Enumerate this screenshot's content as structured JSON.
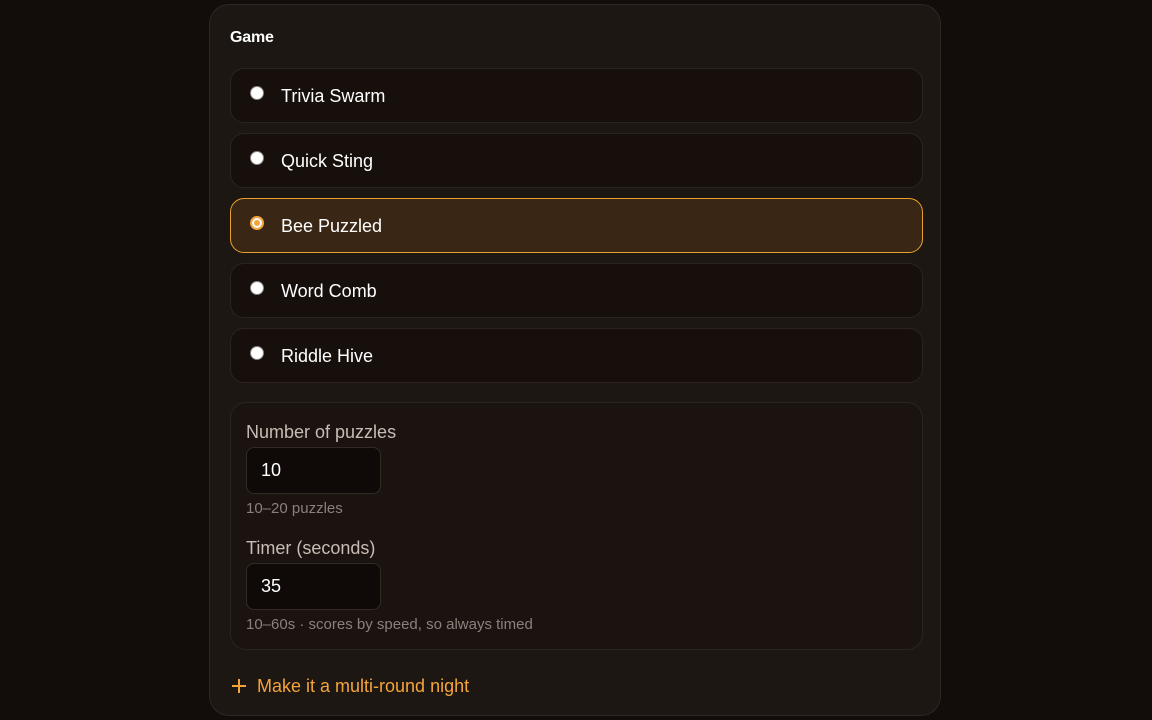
{
  "section": {
    "title": "Game"
  },
  "games": [
    {
      "label": "Trivia Swarm",
      "selected": false
    },
    {
      "label": "Quick Sting",
      "selected": false
    },
    {
      "label": "Bee Puzzled",
      "selected": true
    },
    {
      "label": "Word Comb",
      "selected": false
    },
    {
      "label": "Riddle Hive",
      "selected": false
    }
  ],
  "settings": {
    "puzzles": {
      "label": "Number of puzzles",
      "value": "10",
      "hint": "10–20 puzzles"
    },
    "timer": {
      "label": "Timer (seconds)",
      "value": "35",
      "hint": "10–60s · scores by speed, so always timed"
    }
  },
  "actions": {
    "multi_round": "Make it a multi-round night"
  },
  "colors": {
    "accent": "#f4a43a",
    "background": "#120d0a",
    "panel": "#1d1713",
    "selected_bg": "#3a2614",
    "selected_border": "#e6a12e"
  }
}
